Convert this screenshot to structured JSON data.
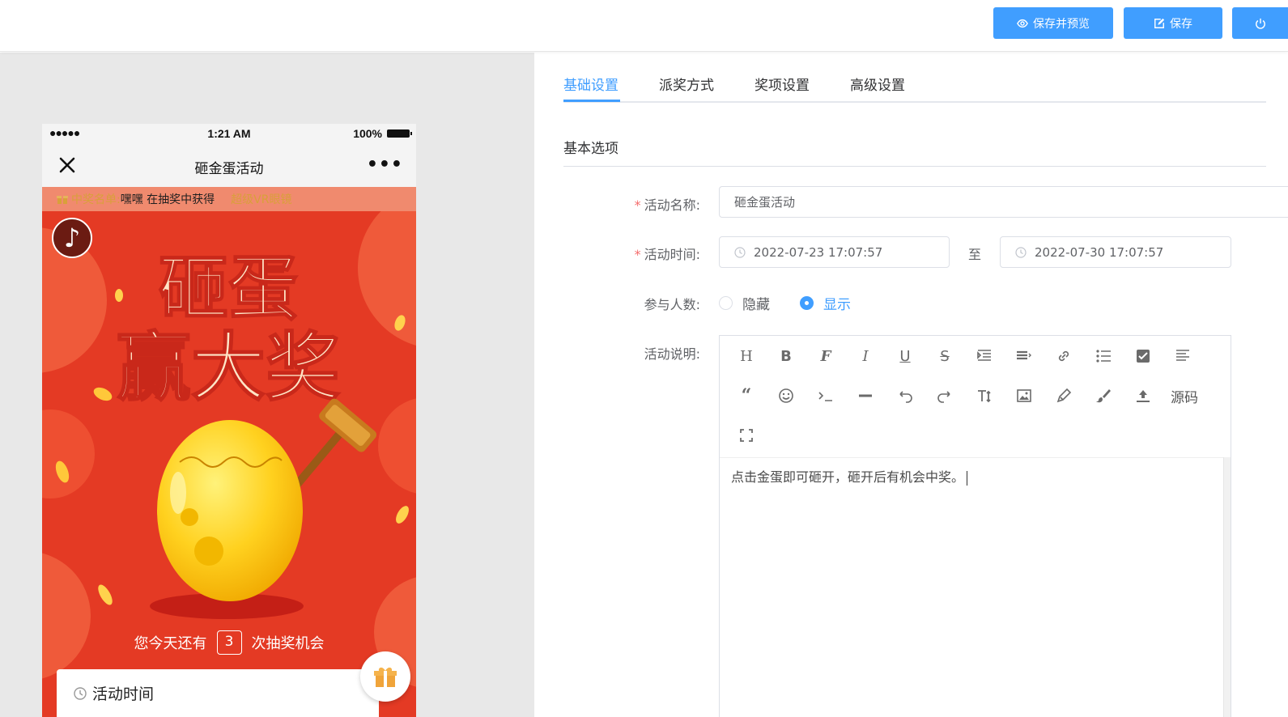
{
  "toolbar": {
    "save_preview_label": "保存并预览",
    "save_label": "保存"
  },
  "preview": {
    "status": {
      "signal": "●●●●●",
      "time": "1:21 AM",
      "battery": "100%"
    },
    "nav_title": "砸金蛋活动",
    "nav_more": "•••",
    "winners": {
      "label": "中奖名单:",
      "name": "嘿嘿 在抽奖中获得",
      "prize": "超级VR眼镜"
    },
    "poster_headline_1": "砸蛋",
    "poster_headline_2": "赢大奖",
    "chances_prefix": "您今天还有",
    "chances_count": "3",
    "chances_suffix": "次抽奖机会",
    "card_title": "活动时间"
  },
  "tabs": [
    "基础设置",
    "派奖方式",
    "奖项设置",
    "高级设置"
  ],
  "section_title": "基本选项",
  "form": {
    "name_label": "活动名称:",
    "name_value": "砸金蛋活动",
    "time_label": "活动时间:",
    "start_time": "2022-07-23 17:07:57",
    "to_label": "至",
    "end_time": "2022-07-30 17:07:57",
    "participants_label": "参与人数:",
    "radio_hide": "隐藏",
    "radio_show": "显示",
    "desc_label": "活动说明:",
    "source_label": "源码",
    "desc_text": "点击金蛋即可砸开，砸开后有机会中奖。"
  },
  "colors": {
    "primary": "#409eff",
    "poster_red": "#e43a24",
    "required": "#f56c6c"
  }
}
